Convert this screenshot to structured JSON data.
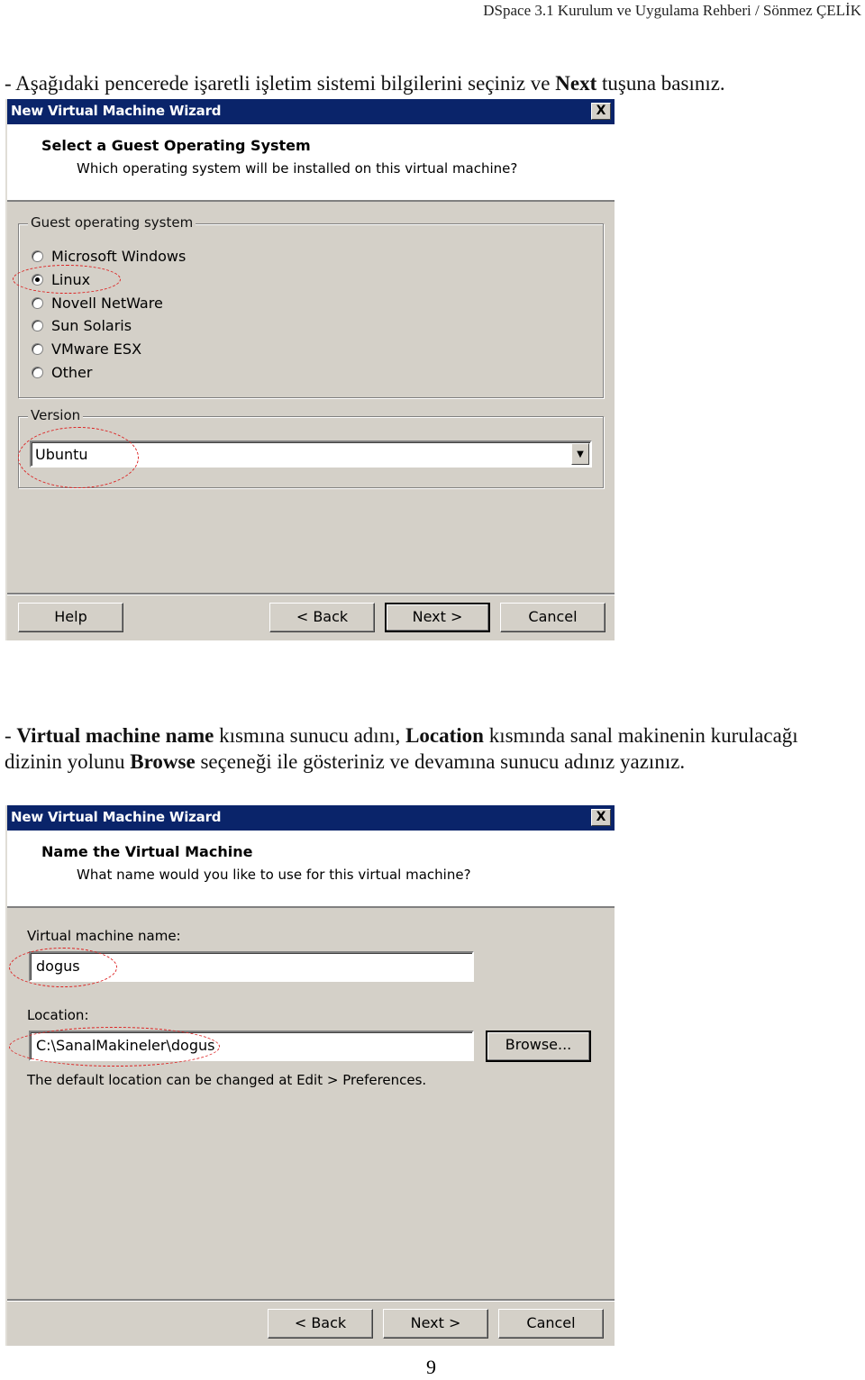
{
  "page_header": "DSpace 3.1  Kurulum ve Uygulama Rehberi / Sönmez ÇELİK",
  "instruction1": {
    "prefix": "- Aşağıdaki pencerede işaretli işletim sistemi bilgilerini seçiniz ve ",
    "bold": "Next",
    "suffix": " tuşuna basınız."
  },
  "dialog1": {
    "title": "New Virtual Machine Wizard",
    "close_label": "X",
    "header_title": "Select a Guest Operating System",
    "header_subtitle": "Which operating system will be installed on this virtual machine?",
    "guest_os_group": "Guest operating system",
    "options": [
      {
        "label": "Microsoft Windows",
        "checked": false
      },
      {
        "label": "Linux",
        "checked": true
      },
      {
        "label": "Novell NetWare",
        "checked": false
      },
      {
        "label": "Sun Solaris",
        "checked": false
      },
      {
        "label": "VMware ESX",
        "checked": false
      },
      {
        "label": "Other",
        "checked": false
      }
    ],
    "version_group": "Version",
    "version_value": "Ubuntu",
    "buttons": {
      "help": "Help",
      "back": "< Back",
      "next": "Next >",
      "cancel": "Cancel"
    }
  },
  "instruction2": {
    "p1": "- ",
    "b1": "Virtual machine name",
    "p2": " kısmına sunucu adını, ",
    "b2": "Location",
    "p3": " kısmında sanal makinenin kurulacağı dizinin yolunu ",
    "b3": "Browse",
    "p4": " seçeneği ile gösteriniz ve devamına sunucu adınız yazınız."
  },
  "dialog2": {
    "title": "New Virtual Machine Wizard",
    "close_label": "X",
    "header_title": "Name the Virtual Machine",
    "header_subtitle": "What name would you like to use for this virtual machine?",
    "name_label": "Virtual machine name:",
    "name_value": "dogus",
    "location_label": "Location:",
    "location_value": "C:\\SanalMakineler\\dogus",
    "browse_label": "Browse...",
    "hint": "The default location can be changed at Edit > Preferences.",
    "buttons": {
      "back": "< Back",
      "next": "Next >",
      "cancel": "Cancel"
    }
  },
  "page_number": "9",
  "colors": {
    "titlebar": "#0a246a",
    "dialog_bg": "#d4d0c8",
    "annotation": "#dd2222"
  }
}
